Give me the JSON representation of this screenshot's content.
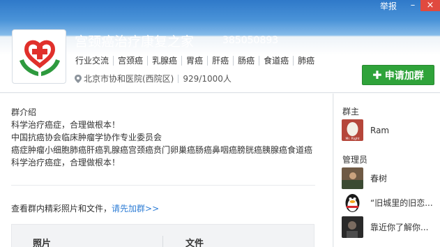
{
  "window": {
    "report_label": "举报",
    "minimize": "–",
    "close": "×"
  },
  "group": {
    "name": "宫颈癌治疗康复之家",
    "id": "385050893",
    "tags": [
      "行业交流",
      "宫颈癌",
      "乳腺癌",
      "胃癌",
      "肝癌",
      "肠癌",
      "食道癌",
      "肺癌"
    ],
    "location": "北京市协和医院(西院区)",
    "members": "929/1000人",
    "join_label": "申请加群"
  },
  "intro": {
    "title": "群介绍",
    "lines": [
      "科学治疗癌症，合理做根本！",
      "中国抗癌协会临床肿瘤学协作专业委员会",
      "癌症肿瘤小细胞肺癌肝癌乳腺癌宫颈癌贲门卵巢癌肠癌鼻咽癌膀胱癌胰腺癌食道癌",
      "科学治疗癌症，合理做根本！"
    ]
  },
  "files": {
    "prompt": "查看群内精彩照片和文件，",
    "link": "请先加群>>",
    "tab_photos": "照片",
    "tab_files": "文件"
  },
  "sidebar": {
    "owner_title": "群主",
    "owner": {
      "name": "Ram",
      "avatar_text": "Mr. Right"
    },
    "admins_title": "管理员",
    "admins": [
      {
        "name": "春树"
      },
      {
        "name": "“旧城里的旧恋..."
      },
      {
        "name": "靠近你了解你..."
      }
    ]
  },
  "colors": {
    "header_blue": "#2f79c9",
    "join_green": "#2fa33a",
    "link_blue": "#2f7ed6"
  }
}
